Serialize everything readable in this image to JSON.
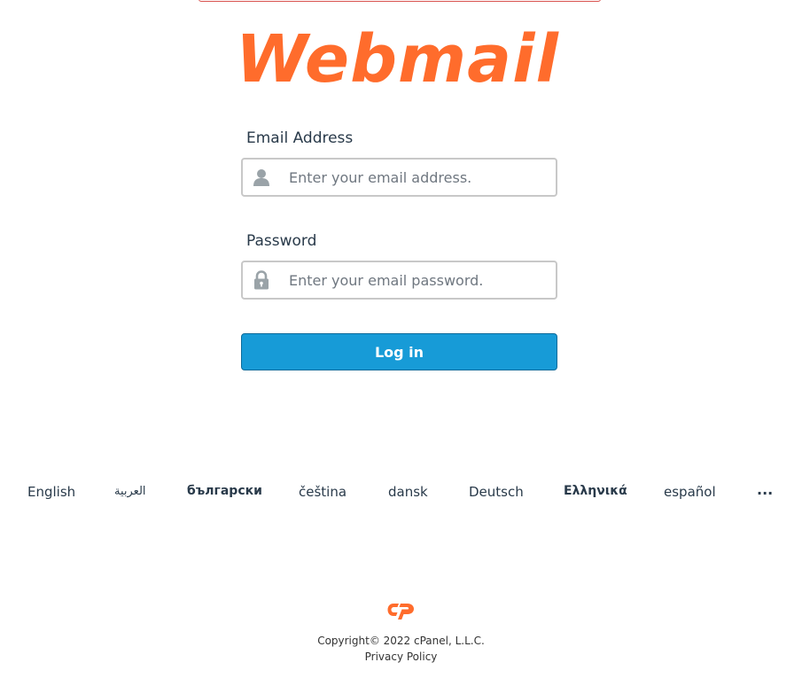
{
  "brand": {
    "logo_text": "Webmail",
    "accent_color": "#ff6c2c",
    "button_color": "#179bd7"
  },
  "form": {
    "email_label": "Email Address",
    "email_placeholder": "Enter your email address.",
    "email_icon": "user-icon",
    "password_label": "Password",
    "password_placeholder": "Enter your email password.",
    "password_icon": "lock-icon",
    "login_label": "Log in"
  },
  "languages": {
    "items": [
      "English",
      "العربية",
      "български",
      "čeština",
      "dansk",
      "Deutsch",
      "Ελληνικά",
      "español"
    ],
    "more_label": "..."
  },
  "footer": {
    "copyright": "Copyright© 2022 cPanel, L.L.C.",
    "privacy_label": "Privacy Policy",
    "cpanel_logo_icon": "cpanel-logo-icon"
  }
}
